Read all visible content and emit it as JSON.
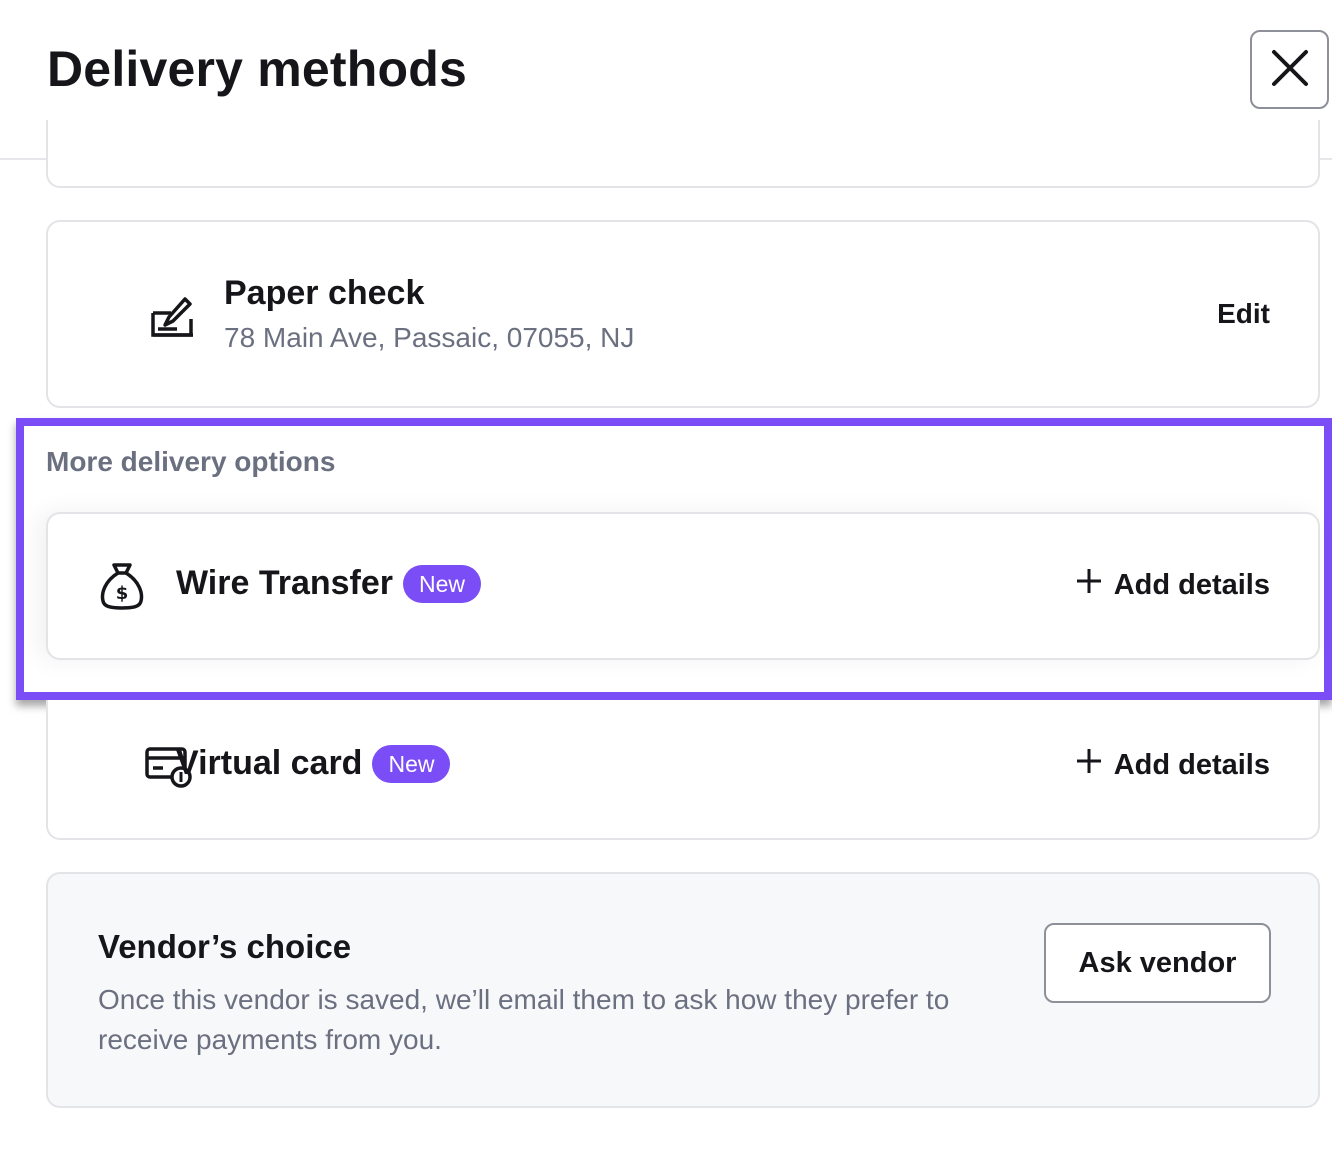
{
  "header": {
    "title": "Delivery methods",
    "close_icon": "close-icon"
  },
  "paper_check": {
    "icon": "paper-check-icon",
    "title": "Paper check",
    "address": "78 Main Ave, Passaic, 07055, NJ",
    "edit_label": "Edit"
  },
  "more_options": {
    "label": "More delivery options",
    "highlight_color": "#7a4df6",
    "wire_transfer": {
      "icon": "money-bag-icon",
      "title": "Wire Transfer",
      "badge": "New",
      "add_label": "Add details"
    }
  },
  "virtual_card": {
    "icon": "virtual-card-icon",
    "title": "Virtual card",
    "badge": "New",
    "add_label": "Add details"
  },
  "vendor_choice": {
    "title": "Vendor’s choice",
    "description": "Once this vendor is saved, we’ll email them to ask how they prefer to receive payments from you.",
    "button_label": "Ask vendor"
  },
  "colors": {
    "badge": "#7a4df6",
    "secondary_text": "#6b7081",
    "border": "#e3e4e8"
  }
}
